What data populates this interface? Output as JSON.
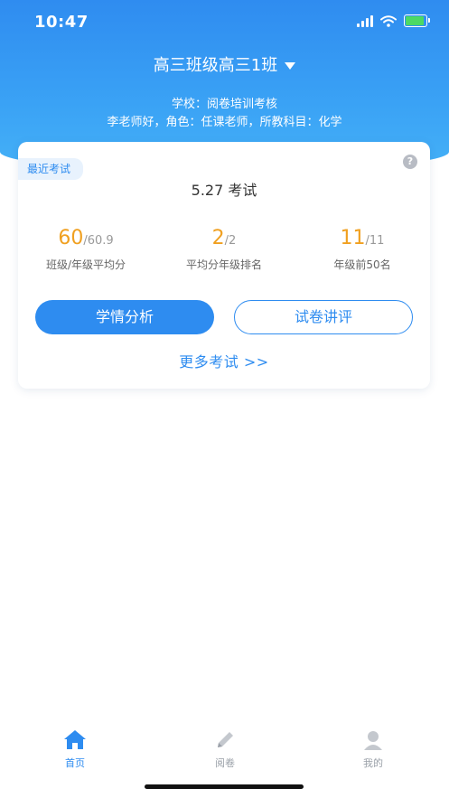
{
  "status_bar": {
    "time": "10:47"
  },
  "header": {
    "class_name": "高三班级高三1班",
    "school_line": "学校：阅卷培训考核",
    "teacher_line": "李老师好，角色：任课老师，所教科目：化学"
  },
  "card": {
    "tag": "最近考试",
    "help_symbol": "?",
    "exam_name": "5.27 考试",
    "stats": [
      {
        "value": "60",
        "total": "/60.9",
        "label": "班级/年级平均分"
      },
      {
        "value": "2",
        "total": "/2",
        "label": "平均分年级排名"
      },
      {
        "value": "11",
        "total": "/11",
        "label": "年级前50名"
      }
    ],
    "buttons": {
      "analysis": "学情分析",
      "review": "试卷讲评"
    },
    "more_link": "更多考试 >>"
  },
  "tabs": [
    {
      "label": "首页",
      "icon": "home-icon",
      "color": "#2e8cf0"
    },
    {
      "label": "阅卷",
      "icon": "pencil-icon",
      "color": "#9aa0a8"
    },
    {
      "label": "我的",
      "icon": "user-icon",
      "color": "#9aa0a8"
    }
  ],
  "colors": {
    "primary": "#2e8cf0",
    "highlight": "#f0a020"
  }
}
